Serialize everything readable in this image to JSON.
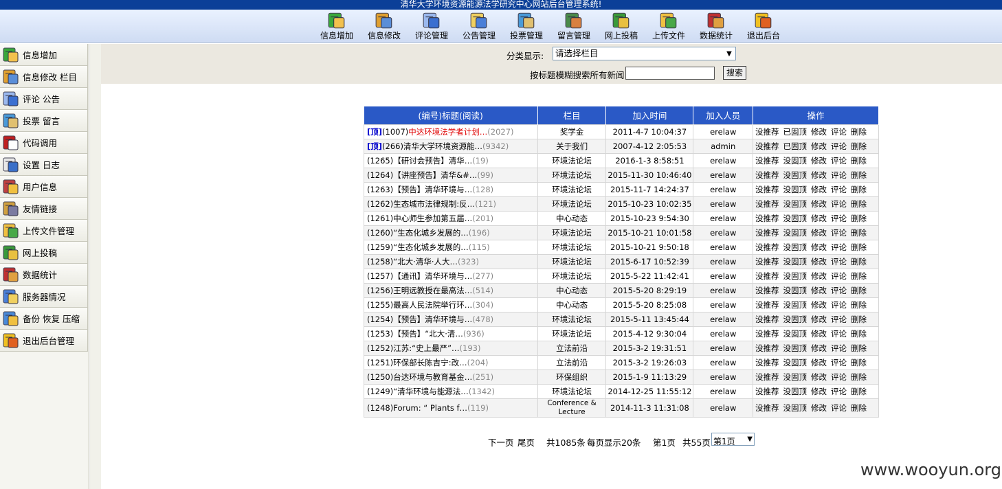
{
  "window_title": "清华大学环境资源能源法学研究中心网站后台管理系统!",
  "toolbar": [
    {
      "label": "信息增加",
      "icon": "add-info-icon"
    },
    {
      "label": "信息修改",
      "icon": "edit-info-icon"
    },
    {
      "label": "评论管理",
      "icon": "comment-icon"
    },
    {
      "label": "公告管理",
      "icon": "announce-icon"
    },
    {
      "label": "投票管理",
      "icon": "vote-icon"
    },
    {
      "label": "留言管理",
      "icon": "message-icon"
    },
    {
      "label": "网上投稿",
      "icon": "submit-icon"
    },
    {
      "label": "上传文件",
      "icon": "upload-icon"
    },
    {
      "label": "数据统计",
      "icon": "stats-icon"
    },
    {
      "label": "退出后台",
      "icon": "exit-icon"
    }
  ],
  "sidebar": [
    {
      "label": "信息增加",
      "icon": "add-info-icon"
    },
    {
      "label": "信息修改 栏目",
      "icon": "edit-info-icon"
    },
    {
      "label": "评论 公告",
      "icon": "comment-icon"
    },
    {
      "label": "投票 留言",
      "icon": "vote-icon"
    },
    {
      "label": "代码调用",
      "icon": "code-icon"
    },
    {
      "label": "设置 日志",
      "icon": "settings-icon"
    },
    {
      "label": "用户信息",
      "icon": "user-icon"
    },
    {
      "label": "友情链接",
      "icon": "link-icon"
    },
    {
      "label": "上传文件管理",
      "icon": "upload-icon"
    },
    {
      "label": "网上投稿",
      "icon": "submit-icon"
    },
    {
      "label": "数据统计",
      "icon": "stats-icon"
    },
    {
      "label": "服务器情况",
      "icon": "server-icon"
    },
    {
      "label": "备份 恢复 压缩",
      "icon": "backup-icon"
    },
    {
      "label": "退出后台管理",
      "icon": "exit-icon"
    }
  ],
  "filter": {
    "category_label": "分类显示:",
    "category_selected": "请选择栏目",
    "search_label": "按标题模糊搜索所有新闻",
    "search_value": "",
    "search_button": "搜索"
  },
  "table": {
    "headers": [
      "(编号)标题(阅读)",
      "栏目",
      "加入时间",
      "加入人员",
      "操作"
    ],
    "rows": [
      {
        "top": "[顶]",
        "id": "(1007)",
        "title": "中达环境法学者计划…",
        "reads": "(2027)",
        "red": true,
        "column": "奖学金",
        "time": "2011-4-7 10:04:37",
        "user": "erelaw",
        "ops": [
          "没推荐",
          "已固顶",
          "修改",
          "评论",
          "删除"
        ]
      },
      {
        "top": "[顶]",
        "id": "(266)",
        "title": "清华大学环境资源能…",
        "reads": "(9342)",
        "column": "关于我们",
        "time": "2007-4-12 2:05:53",
        "user": "admin",
        "ops": [
          "没推荐",
          "已固顶",
          "修改",
          "评论",
          "删除"
        ]
      },
      {
        "id": "(1265)",
        "title": "【研讨会预告】清华…",
        "reads": "(19)",
        "column": "环境法论坛",
        "time": "2016-1-3 8:58:51",
        "user": "erelaw",
        "ops": [
          "没推荐",
          "没固顶",
          "修改",
          "评论",
          "删除"
        ]
      },
      {
        "id": "(1264)",
        "title": "【讲座预告】清华&#…",
        "reads": "(99)",
        "column": "环境法论坛",
        "time": "2015-11-30 10:46:40",
        "user": "erelaw",
        "ops": [
          "没推荐",
          "没固顶",
          "修改",
          "评论",
          "删除"
        ]
      },
      {
        "id": "(1263)",
        "title": "【预告】清华环境与…",
        "reads": "(128)",
        "column": "环境法论坛",
        "time": "2015-11-7 14:24:37",
        "user": "erelaw",
        "ops": [
          "没推荐",
          "没固顶",
          "修改",
          "评论",
          "删除"
        ]
      },
      {
        "id": "(1262)",
        "title": "生态城市法律规制:反…",
        "reads": "(121)",
        "column": "环境法论坛",
        "time": "2015-10-23 10:02:35",
        "user": "erelaw",
        "ops": [
          "没推荐",
          "没固顶",
          "修改",
          "评论",
          "删除"
        ]
      },
      {
        "id": "(1261)",
        "title": "中心师生参加第五届…",
        "reads": "(201)",
        "column": "中心动态",
        "time": "2015-10-23 9:54:30",
        "user": "erelaw",
        "ops": [
          "没推荐",
          "没固顶",
          "修改",
          "评论",
          "删除"
        ]
      },
      {
        "id": "(1260)",
        "title": "“生态化城乡发展的…",
        "reads": "(196)",
        "column": "环境法论坛",
        "time": "2015-10-21 10:01:58",
        "user": "erelaw",
        "ops": [
          "没推荐",
          "没固顶",
          "修改",
          "评论",
          "删除"
        ]
      },
      {
        "id": "(1259)",
        "title": "“生态化城乡发展的…",
        "reads": "(115)",
        "column": "环境法论坛",
        "time": "2015-10-21 9:50:18",
        "user": "erelaw",
        "ops": [
          "没推荐",
          "没固顶",
          "修改",
          "评论",
          "删除"
        ]
      },
      {
        "id": "(1258)",
        "title": "“北大·清华·人大…",
        "reads": "(323)",
        "column": "环境法论坛",
        "time": "2015-6-17 10:52:39",
        "user": "erelaw",
        "ops": [
          "没推荐",
          "没固顶",
          "修改",
          "评论",
          "删除"
        ]
      },
      {
        "id": "(1257)",
        "title": "【通讯】清华环境与…",
        "reads": "(277)",
        "column": "环境法论坛",
        "time": "2015-5-22 11:42:41",
        "user": "erelaw",
        "ops": [
          "没推荐",
          "没固顶",
          "修改",
          "评论",
          "删除"
        ]
      },
      {
        "id": "(1256)",
        "title": "王明远教授在最高法…",
        "reads": "(514)",
        "column": "中心动态",
        "time": "2015-5-20 8:29:19",
        "user": "erelaw",
        "ops": [
          "没推荐",
          "没固顶",
          "修改",
          "评论",
          "删除"
        ]
      },
      {
        "id": "(1255)",
        "title": "最高人民法院举行环…",
        "reads": "(304)",
        "column": "中心动态",
        "time": "2015-5-20 8:25:08",
        "user": "erelaw",
        "ops": [
          "没推荐",
          "没固顶",
          "修改",
          "评论",
          "删除"
        ]
      },
      {
        "id": "(1254)",
        "title": "【预告】清华环境与…",
        "reads": "(478)",
        "column": "环境法论坛",
        "time": "2015-5-11 13:45:44",
        "user": "erelaw",
        "ops": [
          "没推荐",
          "没固顶",
          "修改",
          "评论",
          "删除"
        ]
      },
      {
        "id": "(1253)",
        "title": "【预告】“北大·清…",
        "reads": "(936)",
        "column": "环境法论坛",
        "time": "2015-4-12 9:30:04",
        "user": "erelaw",
        "ops": [
          "没推荐",
          "没固顶",
          "修改",
          "评论",
          "删除"
        ]
      },
      {
        "id": "(1252)",
        "title": "江苏:“史上最严”…",
        "reads": "(193)",
        "column": "立法前沿",
        "time": "2015-3-2 19:31:51",
        "user": "erelaw",
        "ops": [
          "没推荐",
          "没固顶",
          "修改",
          "评论",
          "删除"
        ]
      },
      {
        "id": "(1251)",
        "title": "环保部长陈吉宁:改…",
        "reads": "(204)",
        "column": "立法前沿",
        "time": "2015-3-2 19:26:03",
        "user": "erelaw",
        "ops": [
          "没推荐",
          "没固顶",
          "修改",
          "评论",
          "删除"
        ]
      },
      {
        "id": "(1250)",
        "title": "台达环境与教育基金…",
        "reads": "(251)",
        "column": "环保组织",
        "time": "2015-1-9 11:13:29",
        "user": "erelaw",
        "ops": [
          "没推荐",
          "没固顶",
          "修改",
          "评论",
          "删除"
        ]
      },
      {
        "id": "(1249)",
        "title": "“清华环境与能源法…",
        "reads": "(1342)",
        "column": "环境法论坛",
        "time": "2014-12-25 11:55:12",
        "user": "erelaw",
        "ops": [
          "没推荐",
          "没固顶",
          "修改",
          "评论",
          "删除"
        ]
      },
      {
        "id": "(1248)",
        "title": "Forum: “ Plants f…",
        "reads": "(119)",
        "column": "Conference & Lecture",
        "time": "2014-11-3 11:31:08",
        "user": "erelaw",
        "ops": [
          "没推荐",
          "没固顶",
          "修改",
          "评论",
          "删除"
        ]
      }
    ]
  },
  "pager": {
    "next": "下一页",
    "last": "尾页",
    "total": "共1085条",
    "per_page": "每页显示20条",
    "current": "第1页",
    "pages": "共55页",
    "select_value": "第1页"
  },
  "watermark": "www.wooyun.org",
  "colors": {
    "header_blue": "#2a59c6",
    "title_blue": "#0b3f98",
    "top_tag": "#0000cc",
    "red_title": "#e00000"
  }
}
